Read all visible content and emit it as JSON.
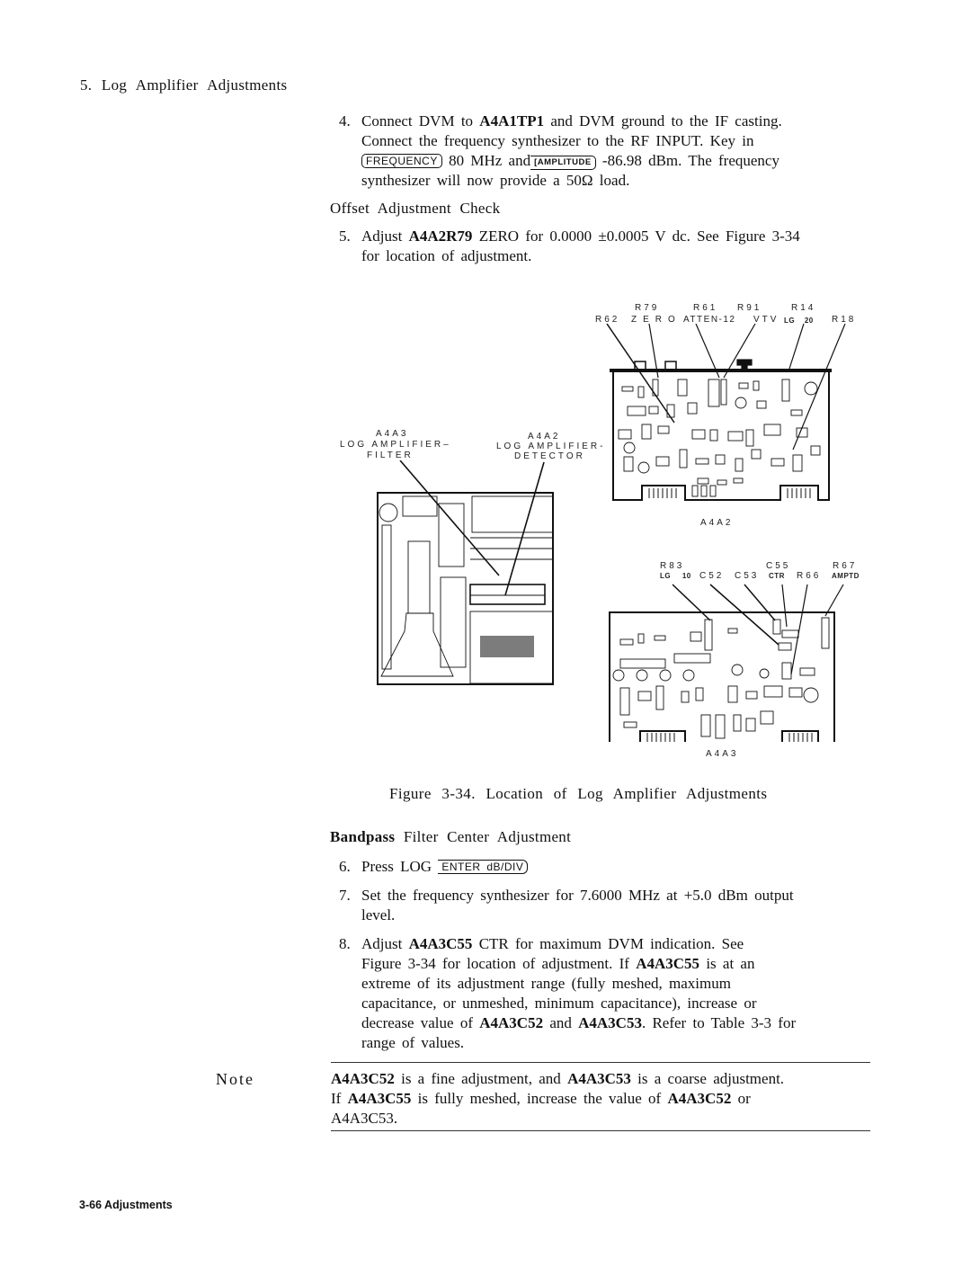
{
  "section": {
    "title": "5. Log Amplifier Adjustments"
  },
  "step4": {
    "number": "4.",
    "line1_pre": "Connect DVM to ",
    "line1_ref": "A4A1TP1",
    "line1_post": " and DVM ground to the IF casting.",
    "line2": "Connect the frequency synthesizer to the RF INPUT. Key in",
    "key_frequency": "FREQUENCY",
    "text_mid": " 80 MHz and",
    "key_amplitude": "[AMPLITUDE",
    "text_after": " -86.98 dBm. The frequency",
    "line4": "synthesizer will now provide a 50Ω load."
  },
  "offset_heading": "Offset Adjustment Check",
  "step5": {
    "number": "5.",
    "pre": "Adjust ",
    "ref": "A4A2R79",
    "post": " ZERO for 0.0000 ±0.0005 V dc. See Figure 3-34",
    "line2": "for location of adjustment."
  },
  "figure": {
    "caption": "Figure 3-34. Location of Log Amplifier Adjustments",
    "overview_labels": {
      "a4a3_ref": "A4A3",
      "a4a3_line1": "LOG AMPLIFIER–",
      "a4a3_line2": "FILTER",
      "a4a2_ref": "A4A2",
      "a4a2_line1": "LOG AMPLIFIER-",
      "a4a2_line2": "DETECTOR"
    },
    "a4a2_board": {
      "name": "A4A2",
      "callouts": [
        {
          "ref": "R62",
          "desc": ""
        },
        {
          "ref": "R79",
          "desc": "ZERO"
        },
        {
          "ref": "R61",
          "desc": "ATTEN-12"
        },
        {
          "ref": "R91",
          "desc": "VTV"
        },
        {
          "ref": "R14",
          "desc": "LG 20"
        },
        {
          "ref": "R18",
          "desc": ""
        }
      ]
    },
    "a4a3_board": {
      "name": "A4A3",
      "callouts": [
        {
          "ref": "R83",
          "desc": "LG 10"
        },
        {
          "ref": "C52",
          "desc": ""
        },
        {
          "ref": "C53",
          "desc": ""
        },
        {
          "ref": "C55",
          "desc": "CTR"
        },
        {
          "ref": "R66",
          "desc": ""
        },
        {
          "ref": "R67",
          "desc": "AMPTD"
        }
      ]
    }
  },
  "bandpass_heading": {
    "bold": "Bandpass",
    "rest": " Filter Center Adjustment"
  },
  "step6": {
    "number": "6.",
    "text": "Press LOG ",
    "key": "ENTER dB/DIV"
  },
  "step7": {
    "number": "7.",
    "line1": "Set the frequency synthesizer for 7.6000 MHz at +5.0 dBm output",
    "line2": "level."
  },
  "step8": {
    "number": "8.",
    "l1_pre": "Adjust ",
    "l1_ref": "A4A3C55",
    "l1_post": " CTR for maximum DVM indication. See",
    "l2_pre": "Figure 3-34 for location of adjustment. If ",
    "l2_ref": "A4A3C55",
    "l2_post": " is at an",
    "l3": "extreme of its adjustment range (fully meshed, maximum",
    "l4": "capacitance, or unmeshed, minimum capacitance), increase or",
    "l5_pre": "decrease value of ",
    "l5_ref1": "A4A3C52",
    "l5_mid": " and ",
    "l5_ref2": "A4A3C53",
    "l5_post": ". Refer to Table 3-3 for",
    "l6": "range of values."
  },
  "note": {
    "label": "Note",
    "l1_ref1": "A4A3C52",
    "l1_mid": " is a fine adjustment, and ",
    "l1_ref2": "A4A3C53",
    "l1_post": " is a coarse adjustment.",
    "l2_pre": "If ",
    "l2_ref1": "A4A3C55",
    "l2_mid": " is fully meshed, increase the value of ",
    "l2_ref2": "A4A3C52",
    "l2_post": " or",
    "l3": "A4A3C53."
  },
  "footer": {
    "page": "3-66",
    "section": "Adjustments"
  }
}
